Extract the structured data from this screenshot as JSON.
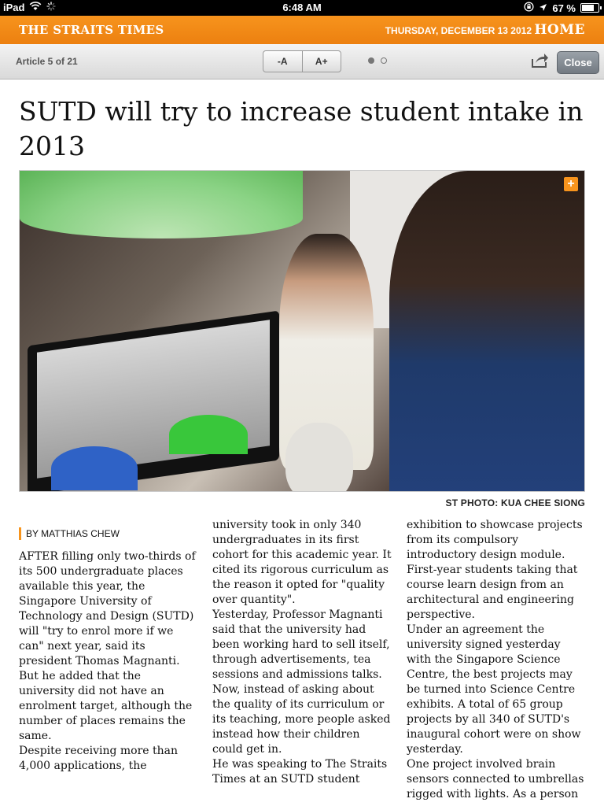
{
  "statusbar": {
    "device": "iPad",
    "time": "6:48 AM",
    "battery": "67 %",
    "battery_level": 0.67
  },
  "banner": {
    "masthead": "THE STRAITS TIMES",
    "date": "THURSDAY, DECEMBER 13 2012",
    "home": "HOME"
  },
  "toolbar": {
    "article_count": "Article 5 of 21",
    "font_smaller": "-A",
    "font_larger": "A+",
    "close": "Close",
    "page_index": 1,
    "page_total": 2
  },
  "article": {
    "headline": "SUTD will try to increase student intake in 2013",
    "photo_credit": "ST PHOTO: KUA CHEE SIONG",
    "byline": "BY MATTHIAS CHEW",
    "col1": [
      "AFTER filling only two-thirds of its 500 undergraduate places available this year, the Singapore University of Technology and Design (SUTD) will \"try to enrol more if we can\" next year, said its president Thomas Magnanti.",
      " But he added that the university did not have an enrolment target, although the number of places remains the same.",
      " Despite receiving more than 4,000 applications, the"
    ],
    "col2": [
      "university took in only 340 undergraduates in its first cohort for this academic year. It cited its rigorous curriculum as the reason it opted for \"quality over quantity\".",
      " Yesterday, Professor Magnanti said that the university had been working hard to sell itself, through advertisements, tea sessions and admissions talks.",
      " Now, instead of asking about the quality of its curriculum or its teaching, more people asked instead how their children could get in.",
      " He was speaking to The Straits Times at an SUTD student"
    ],
    "col3": [
      "exhibition to showcase projects from its compulsory introductory design module. First-year students taking that course learn design from an architectural and engineering perspective.",
      " Under an agreement the university signed yesterday with the Singapore Science Centre, the best projects may be turned into Science Centre exhibits. A total of 65 group projects by all 340 of SUTD's inaugural cohort were on show yesterday.",
      " One project involved brain sensors connected to umbrellas rigged with lights. As a person"
    ]
  },
  "icons": {
    "wifi": "wifi-icon",
    "loading": "activity-spinner-icon",
    "lock": "orientation-lock-icon",
    "location": "location-arrow-icon",
    "battery": "battery-icon",
    "share": "share-icon",
    "expand": "expand-plus-icon"
  },
  "colors": {
    "accent": "#f7941d",
    "close_button": "#858b92"
  }
}
